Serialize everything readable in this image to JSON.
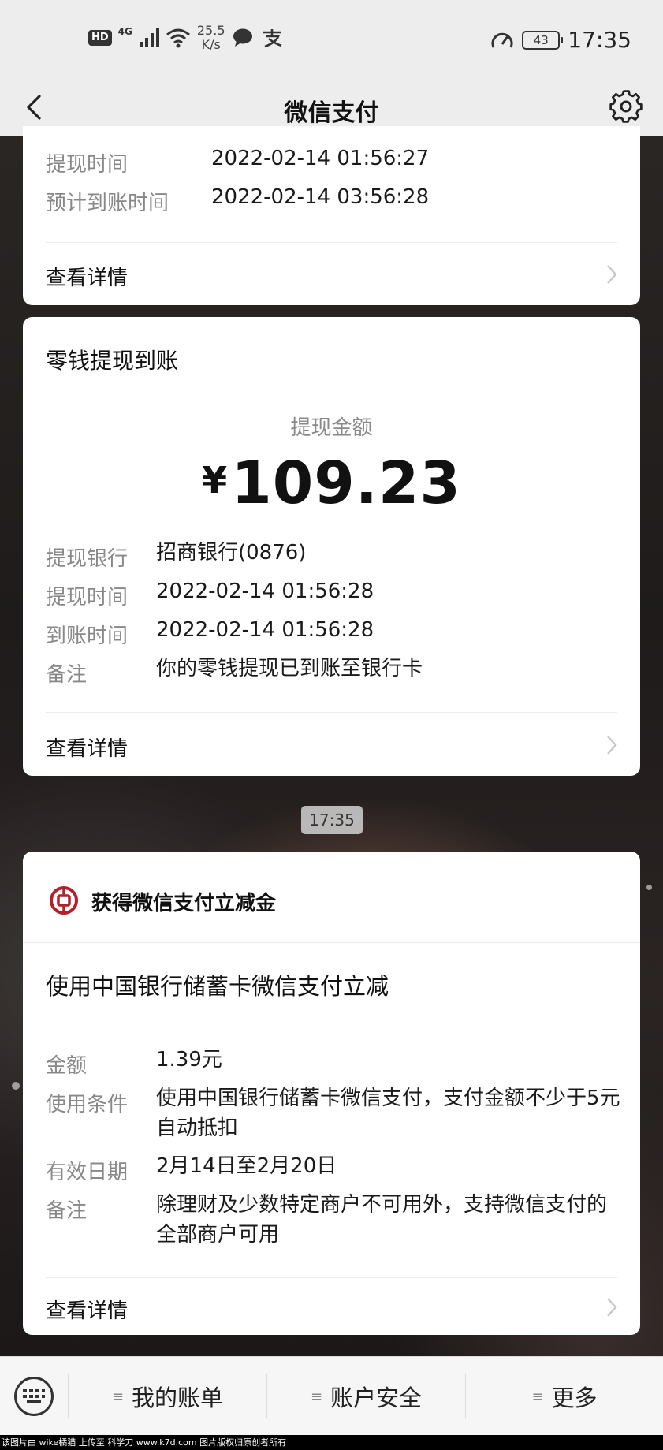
{
  "status_bar": {
    "hd": "HD",
    "network": "4G",
    "speed_value": "25.5",
    "speed_unit": "K/s",
    "battery": "43",
    "time": "17:35"
  },
  "nav": {
    "title": "微信支付"
  },
  "card1": {
    "rows": [
      {
        "label": "提现时间",
        "value": "2022-02-14 01:56:27"
      },
      {
        "label": "预计到账时间",
        "value": "2022-02-14 03:56:28"
      }
    ],
    "detail": "查看详情"
  },
  "card2": {
    "title": "零钱提现到账",
    "amount_label": "提现金额",
    "currency": "¥",
    "amount": "109.23",
    "rows": [
      {
        "label": "提现银行",
        "value": "招商银行(0876)"
      },
      {
        "label": "提现时间",
        "value": "2022-02-14 01:56:28"
      },
      {
        "label": "到账时间",
        "value": "2022-02-14 01:56:28"
      },
      {
        "label": "备注",
        "value": "你的零钱提现已到账至银行卡"
      }
    ],
    "detail": "查看详情"
  },
  "timestamp": "17:35",
  "card3": {
    "header": "获得微信支付立减金",
    "title": "使用中国银行储蓄卡微信支付立减",
    "rows": [
      {
        "label": "金额",
        "value": "1.39元"
      },
      {
        "label": "使用条件",
        "value": "使用中国银行储蓄卡微信支付，支付金额不少于5元自动抵扣"
      },
      {
        "label": "有效日期",
        "value": "2月14日至2月20日"
      },
      {
        "label": "备注",
        "value": "除理财及少数特定商户不可用外，支持微信支付的全部商户可用"
      }
    ],
    "detail": "查看详情",
    "brand_color": "#b3202a"
  },
  "bottom_menu": {
    "items": [
      {
        "label": "我的账单"
      },
      {
        "label": "账户安全"
      },
      {
        "label": "更多"
      }
    ]
  },
  "watermark": "该图片由 wike橘猫 上传至 科学刀 www.k7d.com 图片版权归原创者所有"
}
